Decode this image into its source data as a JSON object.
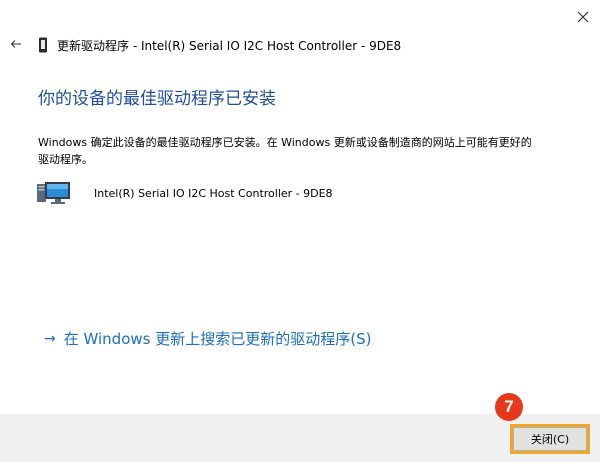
{
  "window": {
    "title": "更新驱动程序 - Intel(R) Serial IO I2C Host Controller - 9DE8",
    "close_icon": "close-icon",
    "back_icon": "back-arrow-icon"
  },
  "main": {
    "heading": "你的设备的最佳驱动程序已安装",
    "description": "Windows 确定此设备的最佳驱动程序已安装。在 Windows 更新或设备制造商的网站上可能有更好的驱动程序。",
    "device_name": "Intel(R) Serial IO I2C Host Controller - 9DE8",
    "search_link": "在 Windows 更新上搜索已更新的驱动程序(S)"
  },
  "footer": {
    "close_button_label": "关闭(C)"
  },
  "annotation": {
    "step_number": "7"
  },
  "colors": {
    "heading": "#1f4e9c",
    "link": "#1a6fc4",
    "highlight_border": "#f0a825",
    "badge": "#e8381b"
  }
}
